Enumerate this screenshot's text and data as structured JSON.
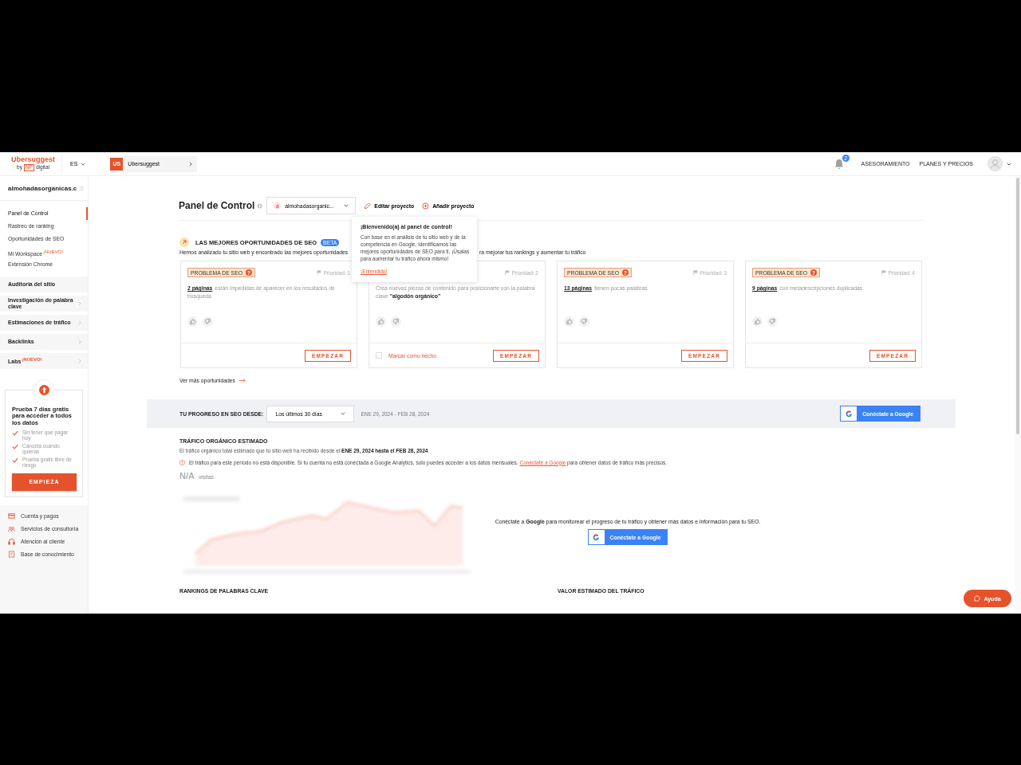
{
  "header": {
    "logo": "Ubersuggest",
    "logo_by": "by",
    "logo_np": "NP",
    "logo_digital": "digital",
    "language": "ES",
    "project_switch": {
      "badge": "US",
      "label": "Ubersuggest"
    },
    "notifications": "2",
    "links": [
      "ASESORAMIENTO",
      "PLANES Y PRECIOS"
    ]
  },
  "sidebar": {
    "project": "almohadasorganicas.c",
    "nav": [
      {
        "label": "Panel de Control",
        "selected": true
      },
      {
        "label": "Rastreo de ranking",
        "selected": false
      },
      {
        "label": "Oportunidades de SEO",
        "selected": false
      },
      {
        "label": "Mi Workspace",
        "selected": false,
        "badge": "¡NUEVO!"
      },
      {
        "label": "Extensión Chrome",
        "selected": false
      }
    ],
    "sections": [
      {
        "label": "Auditoría del sitio",
        "expandable": false
      },
      {
        "label": "Investigación de palabra clave",
        "expandable": true
      },
      {
        "label": "Estimaciones de tráfico",
        "expandable": true
      },
      {
        "label": "Backlinks",
        "expandable": true
      },
      {
        "label": "Labs",
        "expandable": true,
        "badge": "¡NUEVO!"
      }
    ],
    "promo": {
      "title": "Prueba 7 días gratis para acceder a todos los datos",
      "points": [
        "Sin tener que pagar hoy",
        "Cancela cuando quieras",
        "Prueba gratis libre de riesgo"
      ],
      "button": "EMPIEZA"
    },
    "footer": [
      {
        "kind": "card",
        "label": "Cuenta y pagos"
      },
      {
        "kind": "people",
        "label": "Servicios de consultoría"
      },
      {
        "kind": "headset",
        "label": "Atención al cliente"
      },
      {
        "kind": "book",
        "label": "Base de conocimiento"
      }
    ]
  },
  "title_row": {
    "title": "Panel de Control",
    "project": "almohadasorganic...",
    "project_icon": "a",
    "edit": "Editar proyecto",
    "add": "Añadir proyecto"
  },
  "popover": {
    "title": "¡Bienvenido(a) al panel de control!",
    "text": "Con base en el análisis de tu sitio web y de la competencia en Google, identificamos las mejores oportunidades de SEO para ti. ¡Úsalas para aumentar tu tráfico ahora mismo!",
    "link": "¡Entendido!"
  },
  "opportunities": {
    "title": "LAS MEJORES OPORTUNIDADES DE SEO",
    "beta": "BETA",
    "description_left": "Hemos analizado tu sitio web y encontrado las mejores oportunidades",
    "description_right": "ra mejorar tus rankings y aumentar tu tráfico",
    "cards": [
      {
        "badge": "PROBLEMA DE SEO",
        "badge_icon": "?",
        "priority": "Prioridad: 1",
        "link": "2 páginas",
        "text": "están impedidas de aparecer en los resultados de búsqueda",
        "button": "EMPEZAR"
      },
      {
        "priority": "Prioridad: 2",
        "text": "Crea nuevas piezas de contenido para posicionarte con la palabra clave **\"algodón orgánico\"**",
        "mark_done": {
          "label": "Marcar como hecho",
          "checked": false
        },
        "button": "EMPEZAR"
      },
      {
        "badge": "PROBLEMA DE SEO",
        "badge_icon": "?",
        "priority": "Prioridad: 3",
        "link": "13 páginas",
        "text": "tienen pocas palabras",
        "button": "EMPEZAR"
      },
      {
        "badge": "PROBLEMA DE SEO",
        "badge_icon": "?",
        "priority": "Prioridad: 4",
        "link": "9 páginas",
        "text": "con metadescripciones duplicadas",
        "button": "EMPEZAR"
      }
    ],
    "more": "Ver más oportunidades"
  },
  "progress": {
    "label": "TU PROGRESO EN SEO DESDE:",
    "period": "Los últimos 30 días",
    "dates": "ENE 29, 2024 - FEB 28, 2024",
    "connect": "Conéctate a Google"
  },
  "traffic": {
    "title": "TRÁFICO ORGÁNICO ESTIMADO",
    "description": "El tráfico orgánico total estimado que tu sitio web ha recibido desde el **ENE 29, 2024 hasta el FEB 28, 2024**.",
    "warning": "El tráfico para este período no está disponible. Si tu cuenta no está conectada a Google Analytics, solo puedes acceder a los datos mensuales.",
    "warning_link": "Conéctate a Google",
    "warning_end": "para obtener datos de tráfico más precisos.",
    "value": "N/A",
    "unit": "visitas",
    "overlay_text": "Conéctate a **Google** para monitorear el progreso de tu tráfico y obtener más datos e información para tu SEO.",
    "connect": "Conéctate a Google"
  },
  "bottom_headings": [
    "RANKINGS DE PALABRAS CLAVE",
    "VALOR ESTIMADO DEL TRÁFICO"
  ],
  "help": "Ayuda"
}
